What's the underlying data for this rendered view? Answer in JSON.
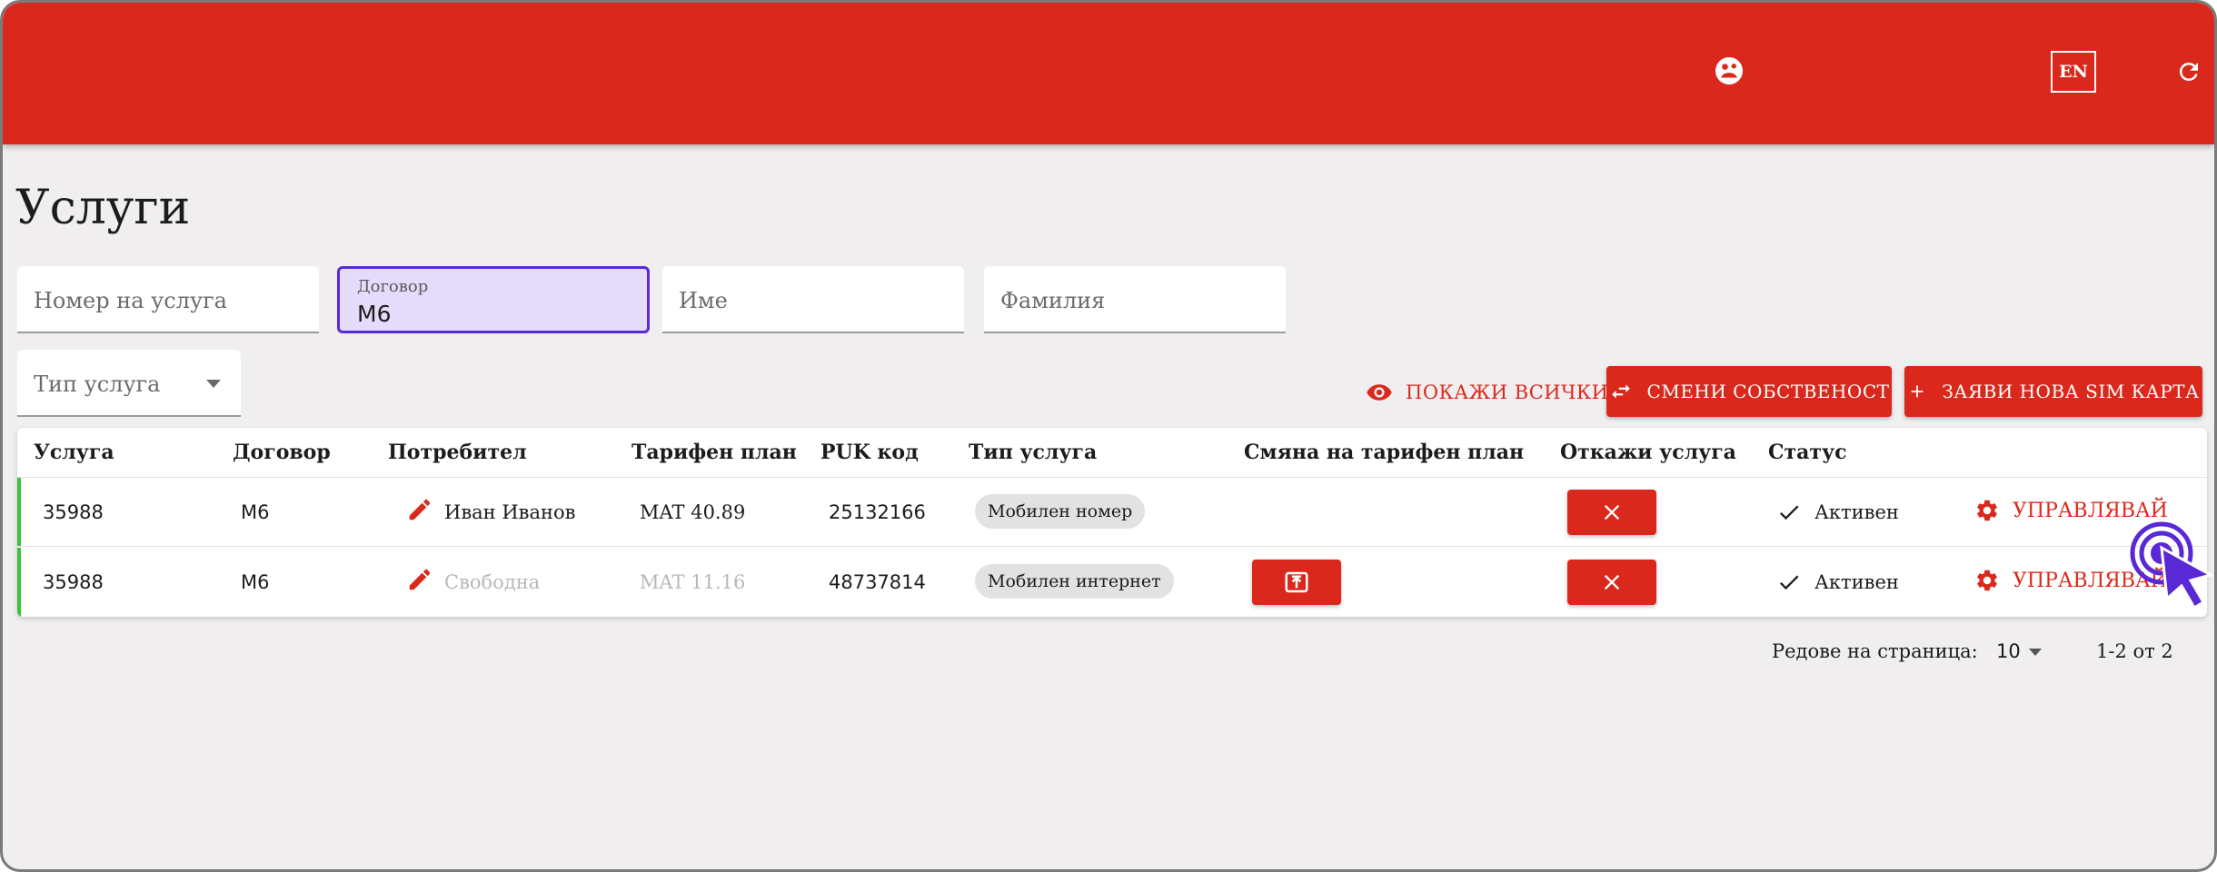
{
  "header": {
    "lang_label": "EN",
    "icons": {
      "user": "user-icon",
      "refresh": "refresh-icon"
    },
    "color": "#da291c"
  },
  "page_title": "Услуги",
  "filters": {
    "service_number_placeholder": "Номер на услуга",
    "contract_label": "Договор",
    "contract_value": "M6",
    "first_name_placeholder": "Име",
    "last_name_placeholder": "Фамилия",
    "service_type_placeholder": "Тип услуга"
  },
  "actions": {
    "show_all_label": "ПОКАЖИ ВСИЧКИ",
    "change_owner_label": "СМЕНИ СОБСТВЕНОСТ",
    "new_sim_label": "ЗАЯВИ НОВА SIM КАРТА"
  },
  "table": {
    "columns": [
      "Услуга",
      "Договор",
      "Потребител",
      "Тарифен план",
      "PUK код",
      "Тип услуга",
      "Смяна на тарифен план",
      "Откажи услуга",
      "Статус"
    ],
    "rows": [
      {
        "service": "35988",
        "contract": "M6",
        "user": "Иван Иванов",
        "plan": "MAT 40.89",
        "puk": "25132166",
        "type": "Мобилен номер",
        "status": "Активен",
        "manage": "УПРАВЛЯВАЙ"
      },
      {
        "service": "35988",
        "contract": "M6",
        "user": "Свободна",
        "plan": "MAT 11.16",
        "puk": "48737814",
        "type": "Мобилен интернет",
        "status": "Активен",
        "manage": "УПРАВЛЯВАЙ"
      }
    ]
  },
  "pagination": {
    "rows_per_page_label": "Редове на страница:",
    "rows_per_page_value": "10",
    "range_label": "1-2 от 2"
  },
  "colors": {
    "accent": "#da291c",
    "focus": "#5a29d6",
    "status_bar": "#3cc13b"
  }
}
